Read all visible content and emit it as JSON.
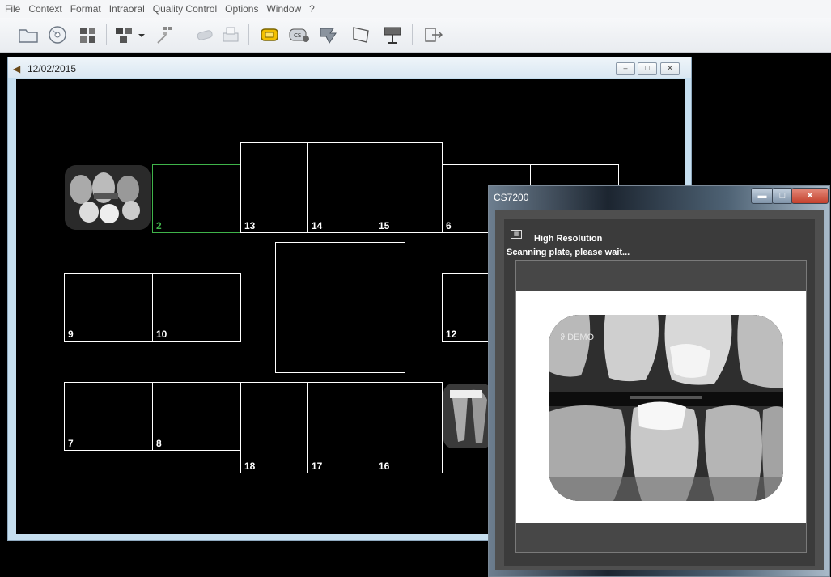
{
  "menu": [
    "File",
    "Context",
    "Format",
    "Intraoral",
    "Quality Control",
    "Options",
    "Window",
    "?"
  ],
  "toolbar_icons": [
    "folder-icon",
    "disc-icon",
    "dental-chart-icon",
    "grid-view-icon",
    "dropdown-arrow-icon",
    "patient-list-icon",
    "sensor-icon",
    "print-icon",
    "imaging-plate-icon",
    "cs-sensor-icon",
    "camera-icon",
    "screen-icon",
    "projector-icon",
    "exit-icon"
  ],
  "child_window": {
    "title": "12/02/2015",
    "controls": [
      "–",
      "□",
      "✕"
    ]
  },
  "slots": [
    {
      "label": "2",
      "active": true
    },
    {
      "label": "13"
    },
    {
      "label": "14"
    },
    {
      "label": "15"
    },
    {
      "label": "6"
    },
    {
      "label": "9"
    },
    {
      "label": "10"
    },
    {
      "label": "12"
    },
    {
      "label": "7"
    },
    {
      "label": "8"
    },
    {
      "label": "18"
    },
    {
      "label": "17"
    },
    {
      "label": "16"
    }
  ],
  "dialog": {
    "title": "CS7200",
    "resolution_label": "High Resolution",
    "status": "Scanning plate, please wait...",
    "watermark": "DEMO",
    "watermark_icon": "ϑ"
  },
  "colors": {
    "active_slot": "#3fb34a",
    "slot_border": "#ffffff",
    "workspace": "#000000"
  }
}
